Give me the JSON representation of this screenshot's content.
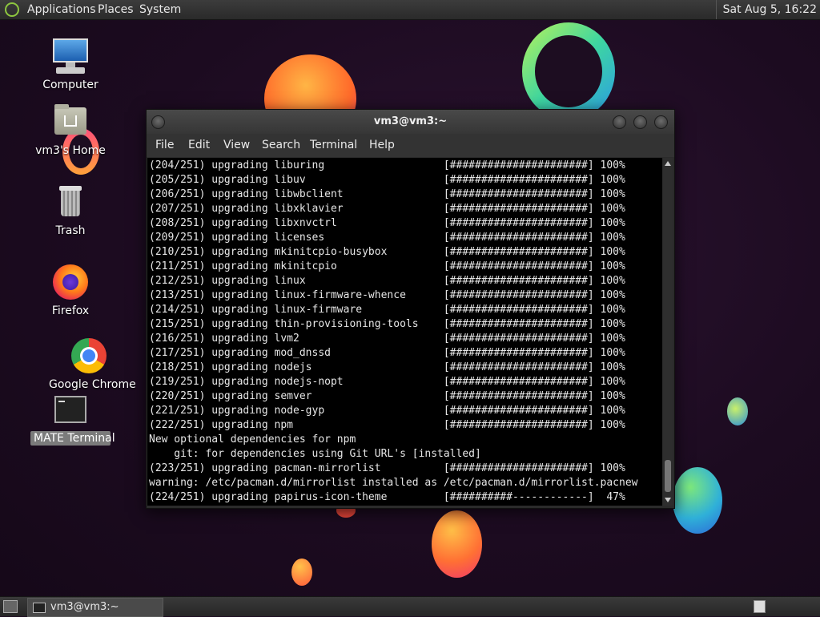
{
  "top_panel": {
    "menus": [
      "Applications",
      "Places",
      "System"
    ],
    "clock": "Sat Aug  5, 16:22"
  },
  "desktop_icons": [
    {
      "label": "Computer"
    },
    {
      "label": "vm3's Home"
    },
    {
      "label": "Trash"
    },
    {
      "label": "Firefox"
    },
    {
      "label": "Google Chrome"
    },
    {
      "label": "MATE Terminal"
    }
  ],
  "terminal": {
    "title": "vm3@vm3:~",
    "menu": [
      "File",
      "Edit",
      "View",
      "Search",
      "Terminal",
      "Help"
    ],
    "lines": [
      "(204/251) upgrading liburing                   [######################] 100%",
      "(205/251) upgrading libuv                      [######################] 100%",
      "(206/251) upgrading libwbclient                [######################] 100%",
      "(207/251) upgrading libxklavier                [######################] 100%",
      "(208/251) upgrading libxnvctrl                 [######################] 100%",
      "(209/251) upgrading licenses                   [######################] 100%",
      "(210/251) upgrading mkinitcpio-busybox         [######################] 100%",
      "(211/251) upgrading mkinitcpio                 [######################] 100%",
      "(212/251) upgrading linux                      [######################] 100%",
      "(213/251) upgrading linux-firmware-whence      [######################] 100%",
      "(214/251) upgrading linux-firmware             [######################] 100%",
      "(215/251) upgrading thin-provisioning-tools    [######################] 100%",
      "(216/251) upgrading lvm2                       [######################] 100%",
      "(217/251) upgrading mod_dnssd                  [######################] 100%",
      "(218/251) upgrading nodejs                     [######################] 100%",
      "(219/251) upgrading nodejs-nopt                [######################] 100%",
      "(220/251) upgrading semver                     [######################] 100%",
      "(221/251) upgrading node-gyp                   [######################] 100%",
      "(222/251) upgrading npm                        [######################] 100%",
      "New optional dependencies for npm",
      "    git: for dependencies using Git URL's [installed]",
      "(223/251) upgrading pacman-mirrorlist          [######################] 100%",
      "warning: /etc/pacman.d/mirrorlist installed as /etc/pacman.d/mirrorlist.pacnew",
      "(224/251) upgrading papirus-icon-theme         [##########------------]  47%"
    ]
  },
  "taskbar": {
    "window_item": "vm3@vm3:~"
  }
}
